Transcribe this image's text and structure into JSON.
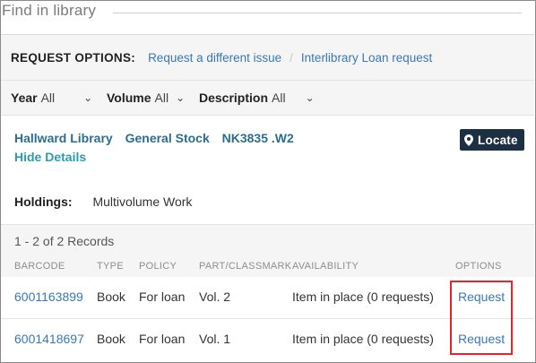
{
  "title": "Find in library",
  "request_options": {
    "label": "REQUEST OPTIONS:",
    "links": [
      "Request a different issue",
      "Interlibrary Loan request"
    ],
    "separator": "/"
  },
  "filters": [
    {
      "label": "Year",
      "value": "All"
    },
    {
      "label": "Volume",
      "value": "All"
    },
    {
      "label": "Description",
      "value": "All"
    }
  ],
  "holding": {
    "library": "Hallward Library",
    "location": "General Stock",
    "call_number": "NK3835 .W2",
    "hide_details": "Hide Details",
    "locate_label": "Locate",
    "holdings_label": "Holdings:",
    "holdings_value": "Multivolume Work"
  },
  "records_summary": "1 - 2 of 2 Records",
  "table": {
    "headers": [
      "BARCODE",
      "TYPE",
      "POLICY",
      "PART/CLASSMARK",
      "AVAILABILITY",
      "OPTIONS"
    ],
    "rows": [
      {
        "barcode": "6001163899",
        "type": "Book",
        "policy": "For loan",
        "part": "Vol. 2",
        "availability": "Item in place (0 requests)",
        "option": "Request"
      },
      {
        "barcode": "6001418697",
        "type": "Book",
        "policy": "For loan",
        "part": "Vol. 1",
        "availability": "Item in place (0 requests)",
        "option": "Request"
      }
    ]
  },
  "colors": {
    "link": "#3978b7",
    "highlight": "#e8232a",
    "locate_bg": "#1d2f42"
  }
}
